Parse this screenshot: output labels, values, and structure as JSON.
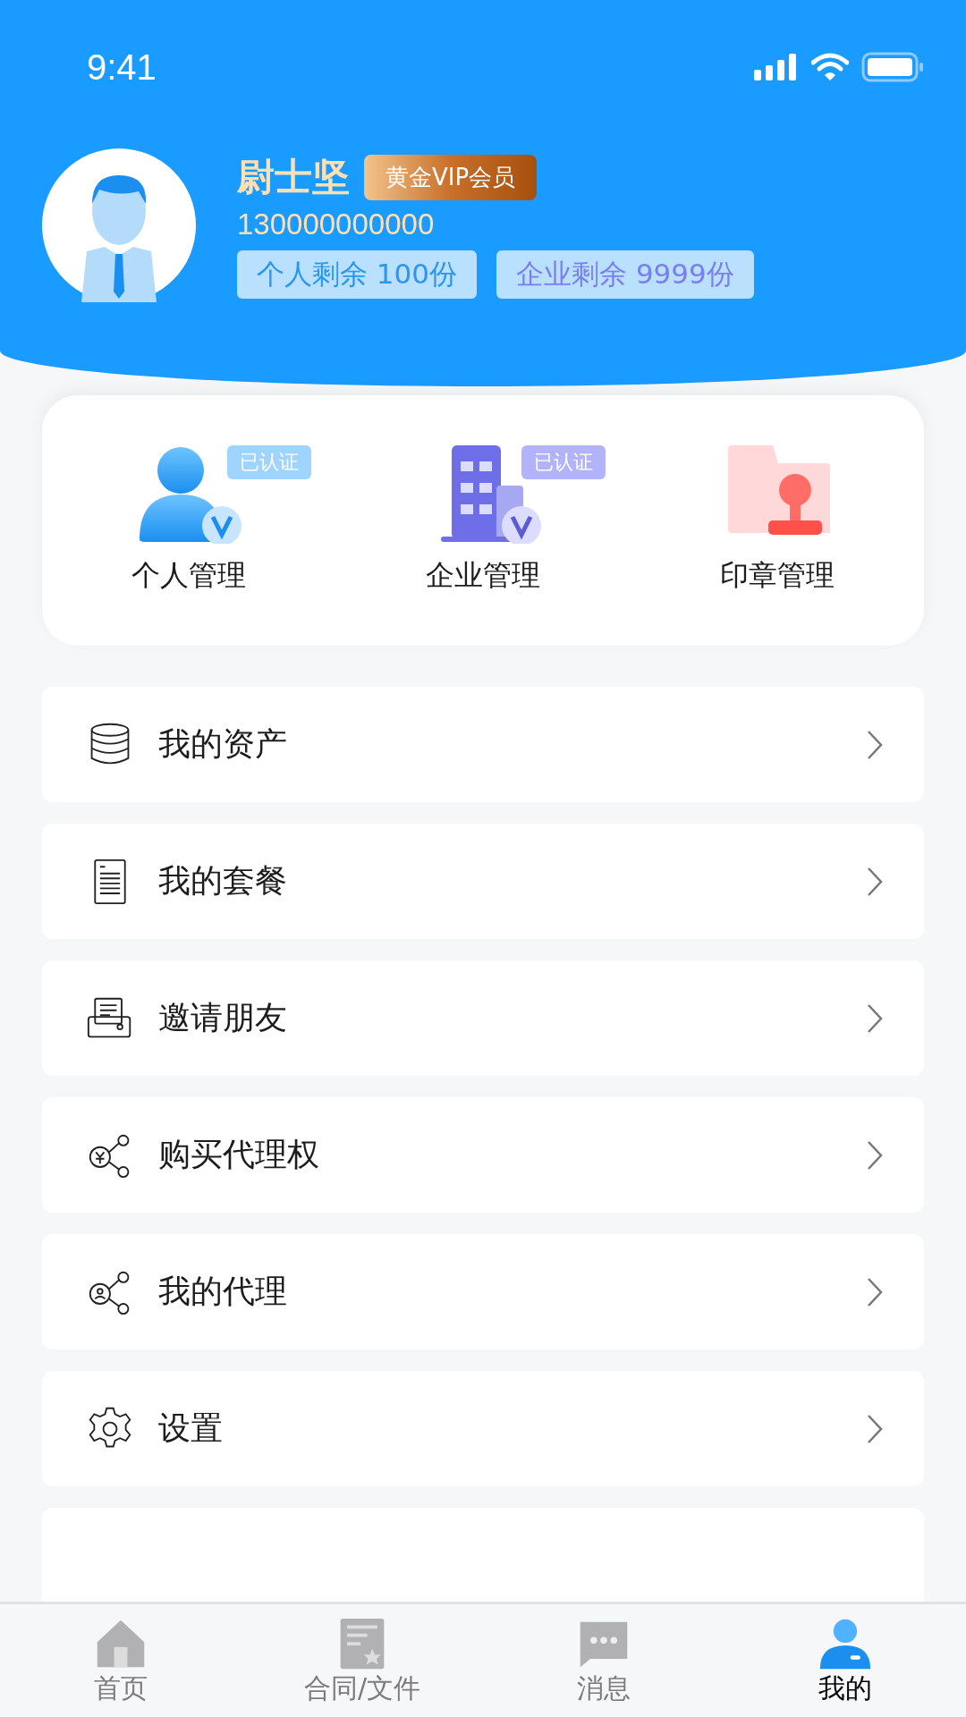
{
  "status_bar": {
    "time": "9:41"
  },
  "profile": {
    "name": "尉士坚",
    "badge": "黄金VIP会员",
    "phone": "130000000000",
    "quotas": [
      {
        "text": "个人剩余 100份",
        "kind": "personal"
      },
      {
        "text": "企业剩余 9999份",
        "kind": "enterprise"
      }
    ]
  },
  "management": [
    {
      "label": "个人管理",
      "kind": "person",
      "badge": "已认证"
    },
    {
      "label": "企业管理",
      "kind": "enterprise",
      "badge": "已认证"
    },
    {
      "label": "印章管理",
      "kind": "seal"
    }
  ],
  "menu": [
    {
      "label": "我的资产",
      "kind": "assets"
    },
    {
      "label": "我的套餐",
      "kind": "package"
    },
    {
      "label": "邀请朋友",
      "kind": "invite"
    },
    {
      "label": "购买代理权",
      "kind": "buy-agency"
    },
    {
      "label": "我的代理",
      "kind": "agency"
    },
    {
      "label": "设置",
      "kind": "settings"
    }
  ],
  "tab_bar": [
    {
      "label": "首页",
      "kind": "home",
      "selected": false
    },
    {
      "label": "合同/文件",
      "kind": "contract",
      "selected": false
    },
    {
      "label": "消息",
      "kind": "message",
      "selected": false
    },
    {
      "label": "我的",
      "kind": "me",
      "selected": true
    }
  ]
}
